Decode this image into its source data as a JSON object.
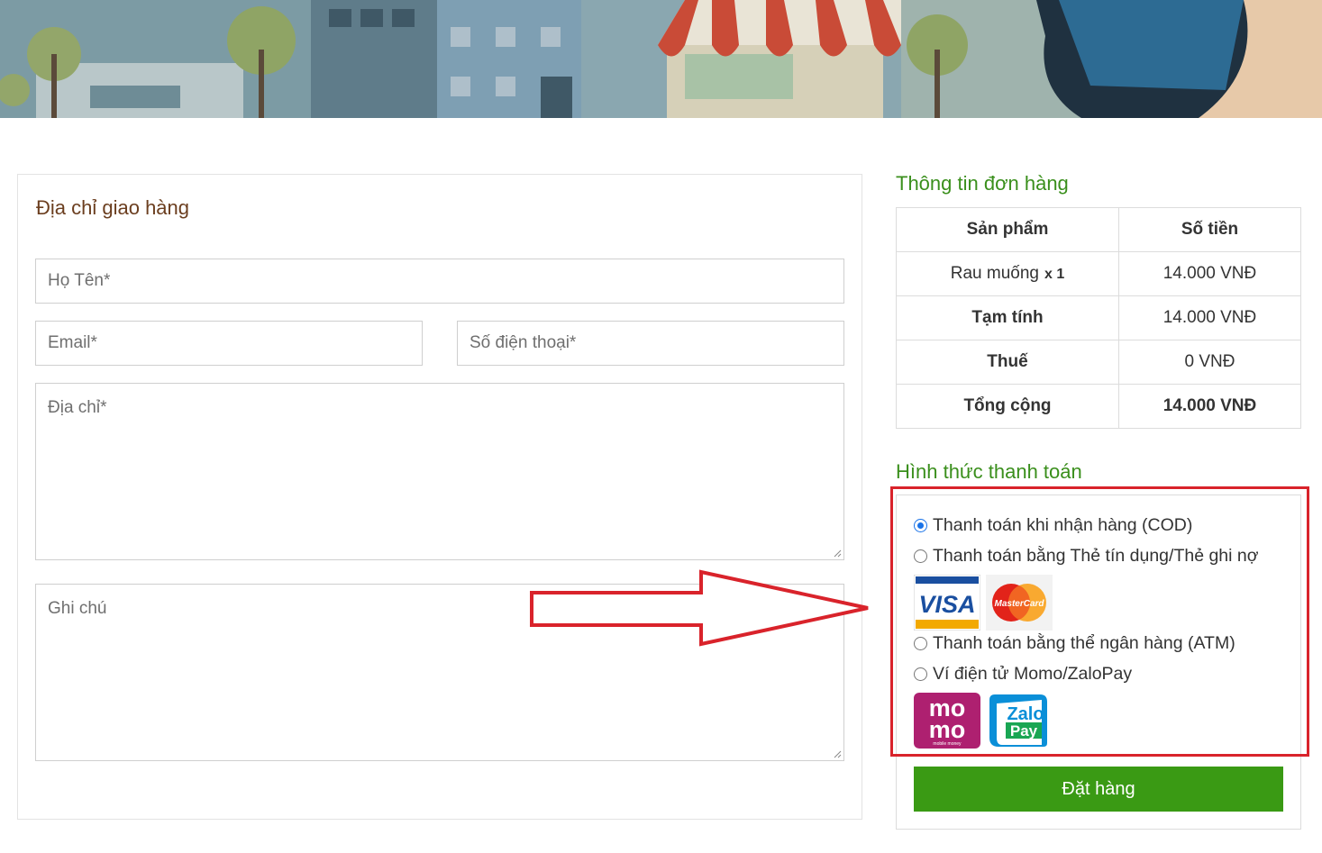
{
  "shipping": {
    "title": "Địa chỉ giao hàng",
    "name_placeholder": "Họ Tên*",
    "email_placeholder": "Email*",
    "phone_placeholder": "Số điện thoại*",
    "address_placeholder": "Địa chỉ*",
    "note_placeholder": "Ghi chú"
  },
  "order": {
    "title": "Thông tin đơn hàng",
    "col_product": "Sản phẩm",
    "col_amount": "Số tiền",
    "item_name": "Rau muống",
    "item_qty": "x 1",
    "item_price": "14.000 VNĐ",
    "subtotal_label": "Tạm tính",
    "subtotal_value": "14.000 VNĐ",
    "tax_label": "Thuế",
    "tax_value": "0 VNĐ",
    "total_label": "Tổng cộng",
    "total_value": "14.000 VNĐ"
  },
  "payment": {
    "title": "Hình thức thanh toán",
    "options": [
      {
        "label": "Thanh toán khi nhận hàng (COD)",
        "checked": true
      },
      {
        "label": "Thanh toán bằng Thẻ tín dụng/Thẻ ghi nợ",
        "checked": false
      },
      {
        "label": "Thanh toán bằng thể ngân hàng (ATM)",
        "checked": false
      },
      {
        "label": "Ví điện tử Momo/ZaloPay",
        "checked": false
      }
    ],
    "logos": {
      "visa": "VISA",
      "mastercard": "MasterCard",
      "momo_line1": "mo",
      "momo_line2": "mo",
      "momo_sub": "mobile money",
      "zalo": "Zalo",
      "zalo_pay": "Pay"
    },
    "submit_label": "Đặt hàng"
  },
  "colors": {
    "accent_green": "#3a9a14",
    "title_green": "#3a8f1c",
    "title_brown": "#6b3e1f",
    "highlight_red": "#d9232b"
  }
}
